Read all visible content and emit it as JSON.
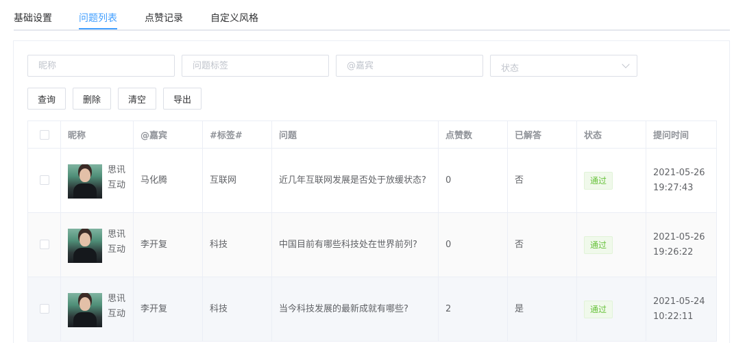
{
  "tabs": [
    {
      "label": "基础设置"
    },
    {
      "label": "问题列表"
    },
    {
      "label": "点赞记录"
    },
    {
      "label": "自定义风格"
    }
  ],
  "filters": {
    "nickname_placeholder": "昵称",
    "tag_placeholder": "问题标签",
    "guest_placeholder": "@嘉宾",
    "status_placeholder": "状态"
  },
  "buttons": {
    "query": "查询",
    "delete": "删除",
    "clear": "清空",
    "export": "导出"
  },
  "table": {
    "headers": [
      "昵称",
      "@嘉宾",
      "#标签#",
      "问题",
      "点赞数",
      "已解答",
      "状态",
      "提问时间"
    ],
    "rows": [
      {
        "nickname": "思讯互动",
        "guest": "马化腾",
        "tag": "互联网",
        "question": "近几年互联网发展是否处于放缓状态?",
        "likes": "0",
        "answered": "否",
        "status": "通过",
        "time": "2021-05-26 19:27:43"
      },
      {
        "nickname": "思讯互动",
        "guest": "李开复",
        "tag": "科技",
        "question": "中国目前有哪些科技处在世界前列?",
        "likes": "0",
        "answered": "否",
        "status": "通过",
        "time": "2021-05-26 19:26:22"
      },
      {
        "nickname": "思讯互动",
        "guest": "李开复",
        "tag": "科技",
        "question": "当今科技发展的最新成就有哪些?",
        "likes": "2",
        "answered": "是",
        "status": "通过",
        "time": "2021-05-24 10:22:11"
      }
    ]
  },
  "colors": {
    "accent": "#409eff",
    "status_pass": "#67c23a"
  }
}
